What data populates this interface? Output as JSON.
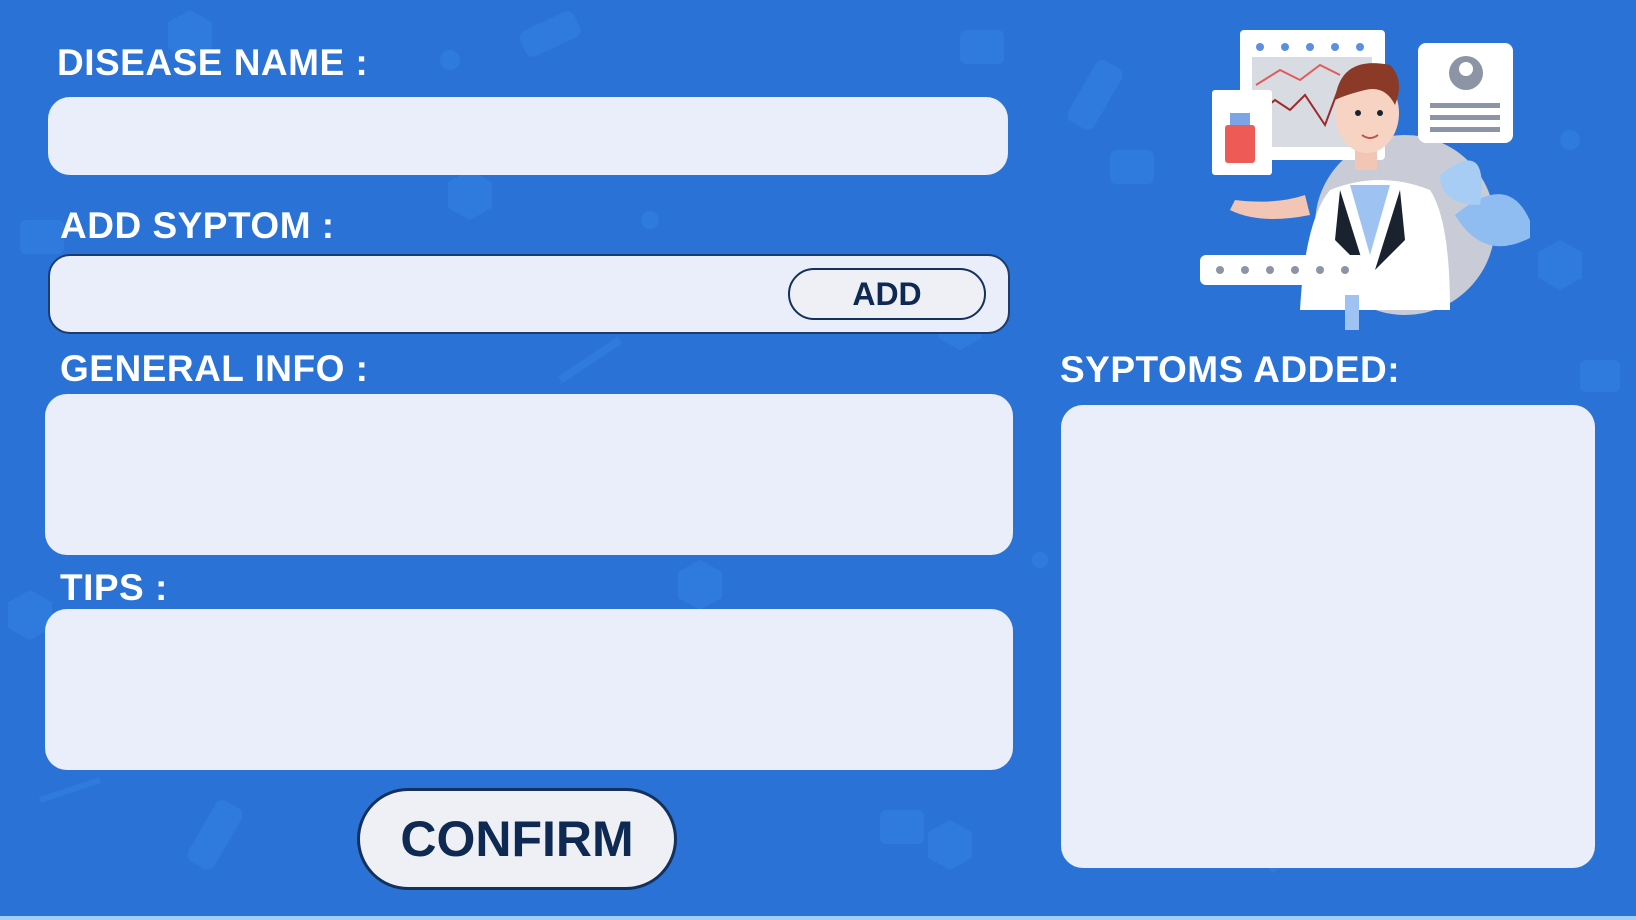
{
  "form": {
    "disease_name_label": "DISEASE NAME :",
    "add_symptom_label": "ADD SYPTOM :",
    "add_button_label": "ADD",
    "general_info_label": "GENERAL INFO :",
    "tips_label": "TIPS :",
    "confirm_button_label": "CONFIRM"
  },
  "symptoms_panel": {
    "label": "SYPTOMS ADDED:"
  },
  "colors": {
    "background": "#2a72d6",
    "field": "#e9eefa",
    "button_text": "#0f2a52"
  },
  "icons": [
    "doctor-illustration",
    "medical-pattern-background"
  ]
}
